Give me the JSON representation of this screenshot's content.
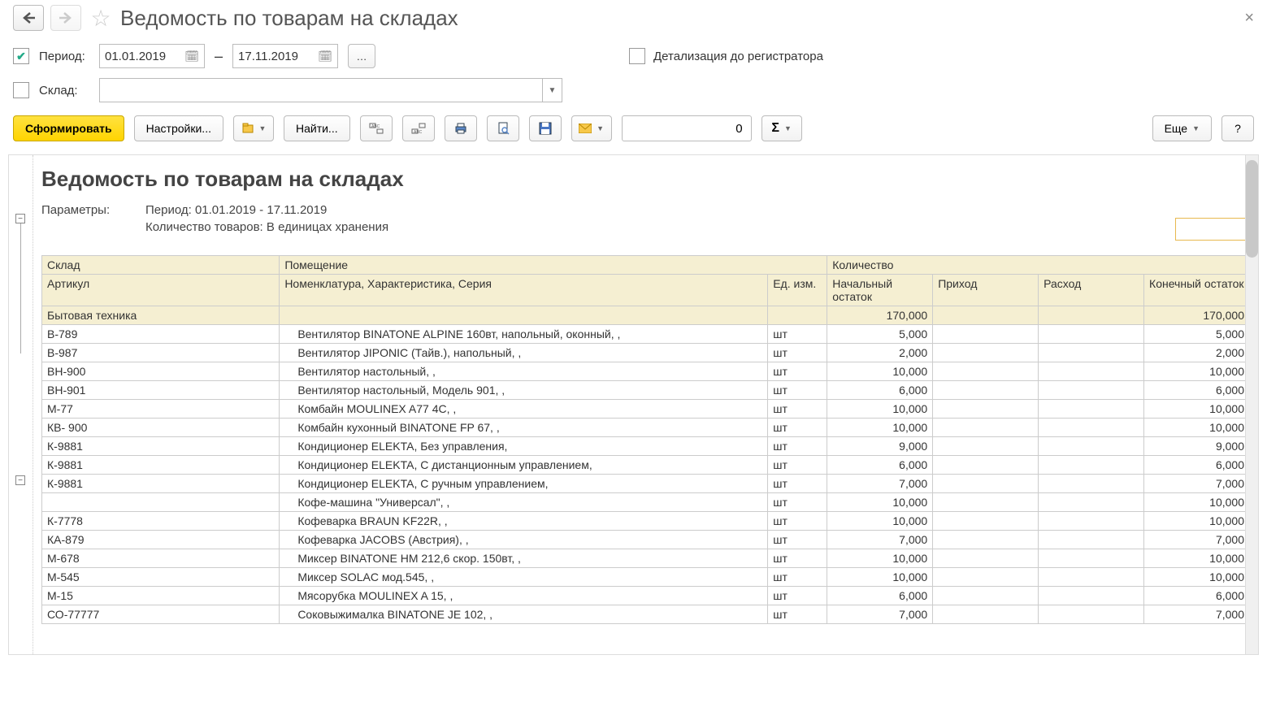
{
  "header": {
    "title": "Ведомость по товарам на складах"
  },
  "filters": {
    "period_checked": true,
    "period_label": "Период:",
    "date_from": "01.01.2019",
    "date_to": "17.11.2019",
    "dash": "–",
    "detail_label": "Детализация до регистратора",
    "warehouse_label": "Склад:",
    "warehouse_value": ""
  },
  "toolbar": {
    "generate": "Сформировать",
    "settings": "Настройки...",
    "find": "Найти...",
    "num_value": "0",
    "more": "Еще",
    "help": "?"
  },
  "report": {
    "title": "Ведомость по товарам на складах",
    "params_label": "Параметры:",
    "params_line1": "Период: 01.01.2019 - 17.11.2019",
    "params_line2": "Количество товаров: В единицах хранения",
    "columns": {
      "warehouse": "Склад",
      "room": "Помещение",
      "qty": "Количество",
      "article": "Артикул",
      "nomenclature": "Номенклатура, Характеристика, Серия",
      "unit": "Ед. изм.",
      "start": "Начальный остаток",
      "in": "Приход",
      "out": "Расход",
      "end": "Конечный остаток"
    },
    "group": {
      "name": "Бытовая техника",
      "start": "170,000",
      "in": "",
      "out": "",
      "end": "170,000"
    },
    "rows": [
      {
        "art": "В-789",
        "nom": "Вентилятор BINATONE ALPINE 160вт, напольный, оконный, ,",
        "ed": "шт",
        "start": "5,000",
        "in": "",
        "out": "",
        "end": "5,000"
      },
      {
        "art": "В-987",
        "nom": "Вентилятор JIPONIC (Тайв.), напольный, ,",
        "ed": "шт",
        "start": "2,000",
        "in": "",
        "out": "",
        "end": "2,000"
      },
      {
        "art": "ВН-900",
        "nom": "Вентилятор настольный, ,",
        "ed": "шт",
        "start": "10,000",
        "in": "",
        "out": "",
        "end": "10,000"
      },
      {
        "art": "ВН-901",
        "nom": "Вентилятор настольный, Модель 901, ,",
        "ed": "шт",
        "start": "6,000",
        "in": "",
        "out": "",
        "end": "6,000"
      },
      {
        "art": "М-77",
        "nom": "Комбайн MOULINEX  A77 4C, ,",
        "ed": "шт",
        "start": "10,000",
        "in": "",
        "out": "",
        "end": "10,000"
      },
      {
        "art": "КВ- 900",
        "nom": "Комбайн кухонный BINATONE FP 67, ,",
        "ed": "шт",
        "start": "10,000",
        "in": "",
        "out": "",
        "end": "10,000"
      },
      {
        "art": "К-9881",
        "nom": "Кондиционер ELEKTA, Без управления,",
        "ed": "шт",
        "start": "9,000",
        "in": "",
        "out": "",
        "end": "9,000"
      },
      {
        "art": "К-9881",
        "nom": "Кондиционер ELEKTA, С дистанционным управлением,",
        "ed": "шт",
        "start": "6,000",
        "in": "",
        "out": "",
        "end": "6,000"
      },
      {
        "art": "К-9881",
        "nom": "Кондиционер ELEKTA, С ручным управлением,",
        "ed": "шт",
        "start": "7,000",
        "in": "",
        "out": "",
        "end": "7,000"
      },
      {
        "art": "",
        "nom": "Кофе-машина \"Универсал\", ,",
        "ed": "шт",
        "start": "10,000",
        "in": "",
        "out": "",
        "end": "10,000"
      },
      {
        "art": "К-7778",
        "nom": "Кофеварка BRAUN KF22R, ,",
        "ed": "шт",
        "start": "10,000",
        "in": "",
        "out": "",
        "end": "10,000"
      },
      {
        "art": "КА-879",
        "nom": "Кофеварка JACOBS (Австрия), ,",
        "ed": "шт",
        "start": "7,000",
        "in": "",
        "out": "",
        "end": "7,000"
      },
      {
        "art": "М-678",
        "nom": "Миксер BINATONE HM 212,6 скор. 150вт, ,",
        "ed": "шт",
        "start": "10,000",
        "in": "",
        "out": "",
        "end": "10,000"
      },
      {
        "art": "М-545",
        "nom": "Миксер SOLAC мод.545, ,",
        "ed": "шт",
        "start": "10,000",
        "in": "",
        "out": "",
        "end": "10,000"
      },
      {
        "art": "М-15",
        "nom": "Мясорубка MOULINEX  A 15, ,",
        "ed": "шт",
        "start": "6,000",
        "in": "",
        "out": "",
        "end": "6,000"
      },
      {
        "art": "СО-77777",
        "nom": "Соковыжималка  BINATONE JE 102, ,",
        "ed": "шт",
        "start": "7,000",
        "in": "",
        "out": "",
        "end": "7,000"
      }
    ]
  }
}
